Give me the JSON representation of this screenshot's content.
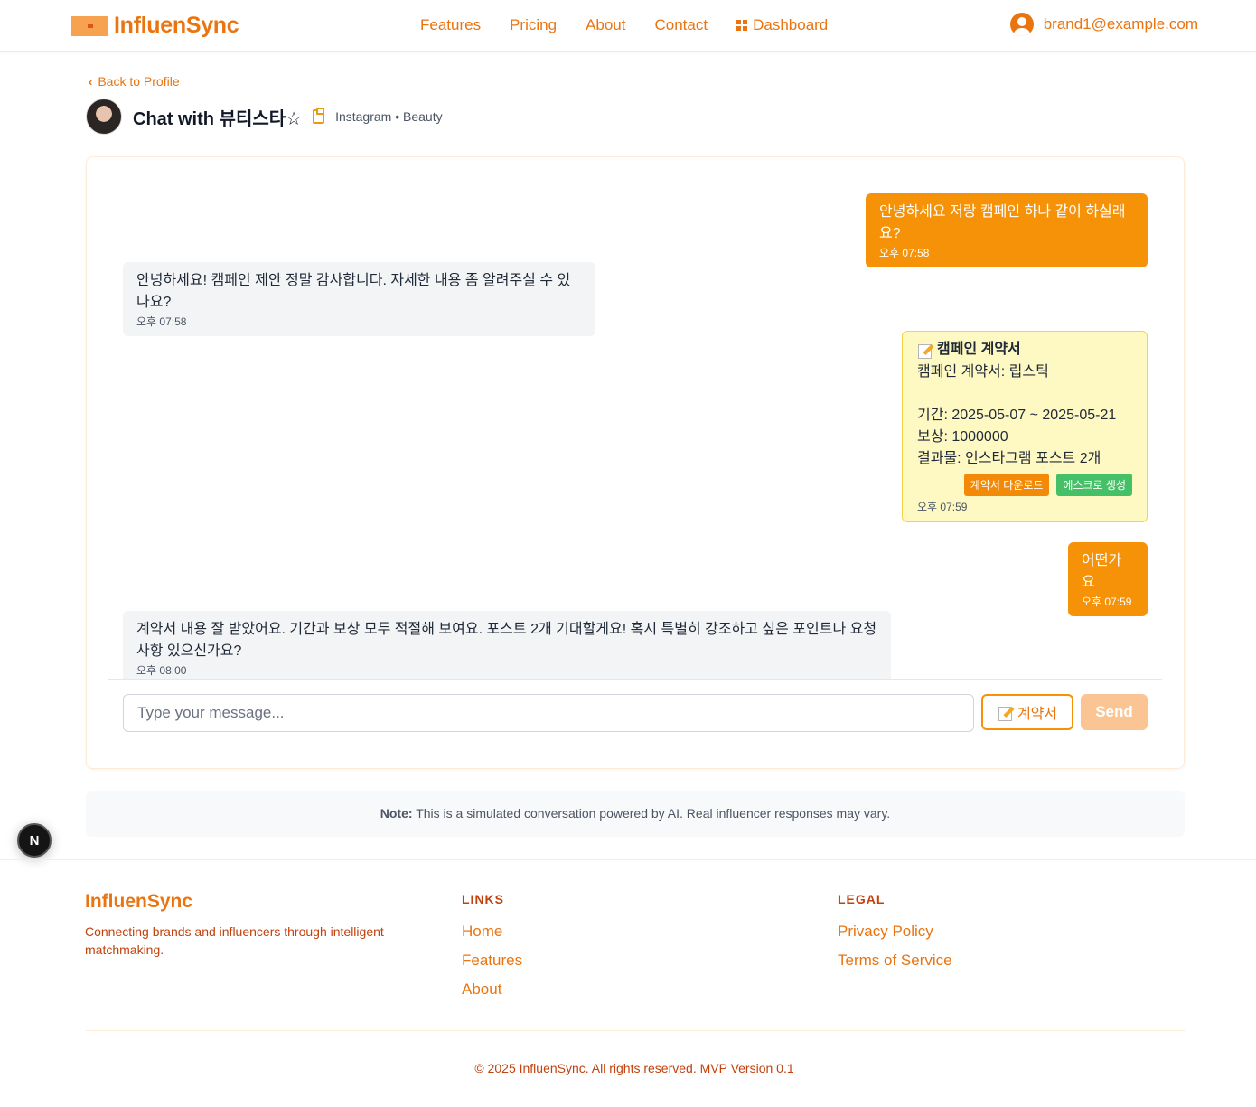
{
  "header": {
    "logo_text": "InfluenSync",
    "nav": [
      "Features",
      "Pricing",
      "About",
      "Contact"
    ],
    "dashboard_label": "Dashboard",
    "user_email": "brand1@example.com"
  },
  "back_link": "Back to Profile",
  "chat": {
    "title": "Chat with 뷰티스타☆",
    "meta": "Instagram • Beauty",
    "messages": [
      {
        "from": "me",
        "text": "안녕하세요 저랑 캠페인 하나 같이 하실래요?",
        "time": "오후 07:58"
      },
      {
        "from": "them",
        "text": "안녕하세요! 캠페인 제안 정말 감사합니다. 자세한 내용 좀 알려주실 수 있나요?",
        "time": "오후 07:58"
      },
      {
        "from": "me",
        "type": "contract",
        "title": "캠페인 계약서",
        "text": "캠페인 계약서: 립스틱\n\n기간: 2025-05-07 ~ 2025-05-21\n보상: 1000000\n결과물: 인스타그램 포스트 2개",
        "download_label": "계약서 다운로드",
        "escrow_label": "에스크로 생성",
        "time": "오후 07:59"
      },
      {
        "from": "me",
        "text": "어떤가요",
        "time": "오후 07:59"
      },
      {
        "from": "them",
        "text": "계약서 내용 잘 받았어요. 기간과 보상 모두 적절해 보여요. 포스트 2개 기대할게요! 혹시 특별히 강조하고 싶은 포인트나 요청사항 있으신가요?",
        "time": "오후 08:00"
      }
    ],
    "input_placeholder": "Type your message...",
    "contract_button": "계약서",
    "send_button": "Send"
  },
  "note": {
    "label": "Note:",
    "text": "This is a simulated conversation powered by AI. Real influencer responses may vary."
  },
  "badge": "N",
  "footer": {
    "brand": "InfluenSync",
    "description": "Connecting brands and influencers through intelligent matchmaking.",
    "links_heading": "LINKS",
    "links": [
      "Home",
      "Features",
      "About"
    ],
    "legal_heading": "LEGAL",
    "legal": [
      "Privacy Policy",
      "Terms of Service"
    ],
    "copyright": "© 2025 InfluenSync. All rights reserved. MVP Version 0.1"
  },
  "colors": {
    "brand": "#ea7410",
    "my_bubble": "#f59208",
    "their_bubble": "#f3f4f6",
    "contract_bubble": "#fef8c2",
    "escrow_button": "#46c066"
  }
}
